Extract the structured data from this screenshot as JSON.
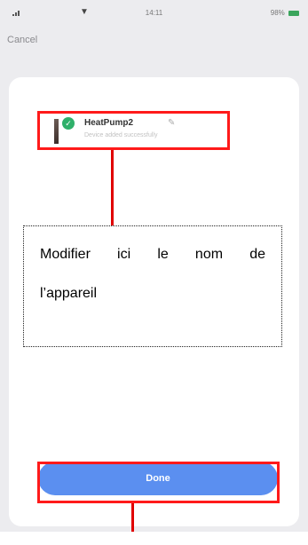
{
  "status_bar": {
    "time": "14:11",
    "battery": "98%",
    "battery_color": "#3aa55c"
  },
  "header": {
    "cancel_label": "Cancel"
  },
  "device": {
    "name": "HeatPump2",
    "subtitle": "Device added successfully",
    "status_icon": "check-icon",
    "edit_icon": "pencil-icon"
  },
  "annotation": {
    "text_line1": "Modifier ici le nom de",
    "text_line2": "l’appareil",
    "highlight_color": "#ff1a1a"
  },
  "footer": {
    "done_label": "Done",
    "done_color": "#5b8ff0"
  }
}
